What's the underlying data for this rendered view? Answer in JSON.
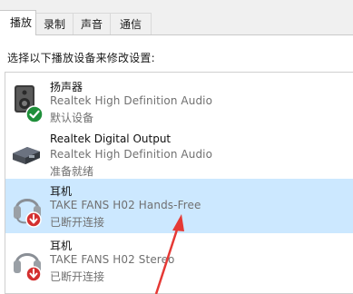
{
  "tabs": [
    {
      "label": "播放"
    },
    {
      "label": "录制"
    },
    {
      "label": "声音"
    },
    {
      "label": "通信"
    }
  ],
  "instruction": "选择以下播放设备来修改设置:",
  "devices": [
    {
      "name": "扬声器",
      "desc": "Realtek High Definition Audio",
      "status": "默认设备",
      "icon": "speaker-icon",
      "badge": "default-check-icon"
    },
    {
      "name": "Realtek Digital Output",
      "desc": "Realtek High Definition Audio",
      "status": "准备就绪",
      "icon": "digital-output-icon"
    },
    {
      "name": "耳机",
      "desc": "TAKE FANS H02 Hands-Free",
      "status": "已断开连接",
      "icon": "headset-icon",
      "badge": "disconnected-arrow-icon"
    },
    {
      "name": "耳机",
      "desc": "TAKE FANS H02 Stereo",
      "status": "已断开连接",
      "icon": "headphones-icon",
      "badge": "disconnected-arrow-icon"
    }
  ],
  "colors": {
    "selection": "#cce8ff",
    "annotation_arrow": "#e53935",
    "check_badge": "#1f8f3a",
    "disconnect_badge": "#d32f2f"
  }
}
